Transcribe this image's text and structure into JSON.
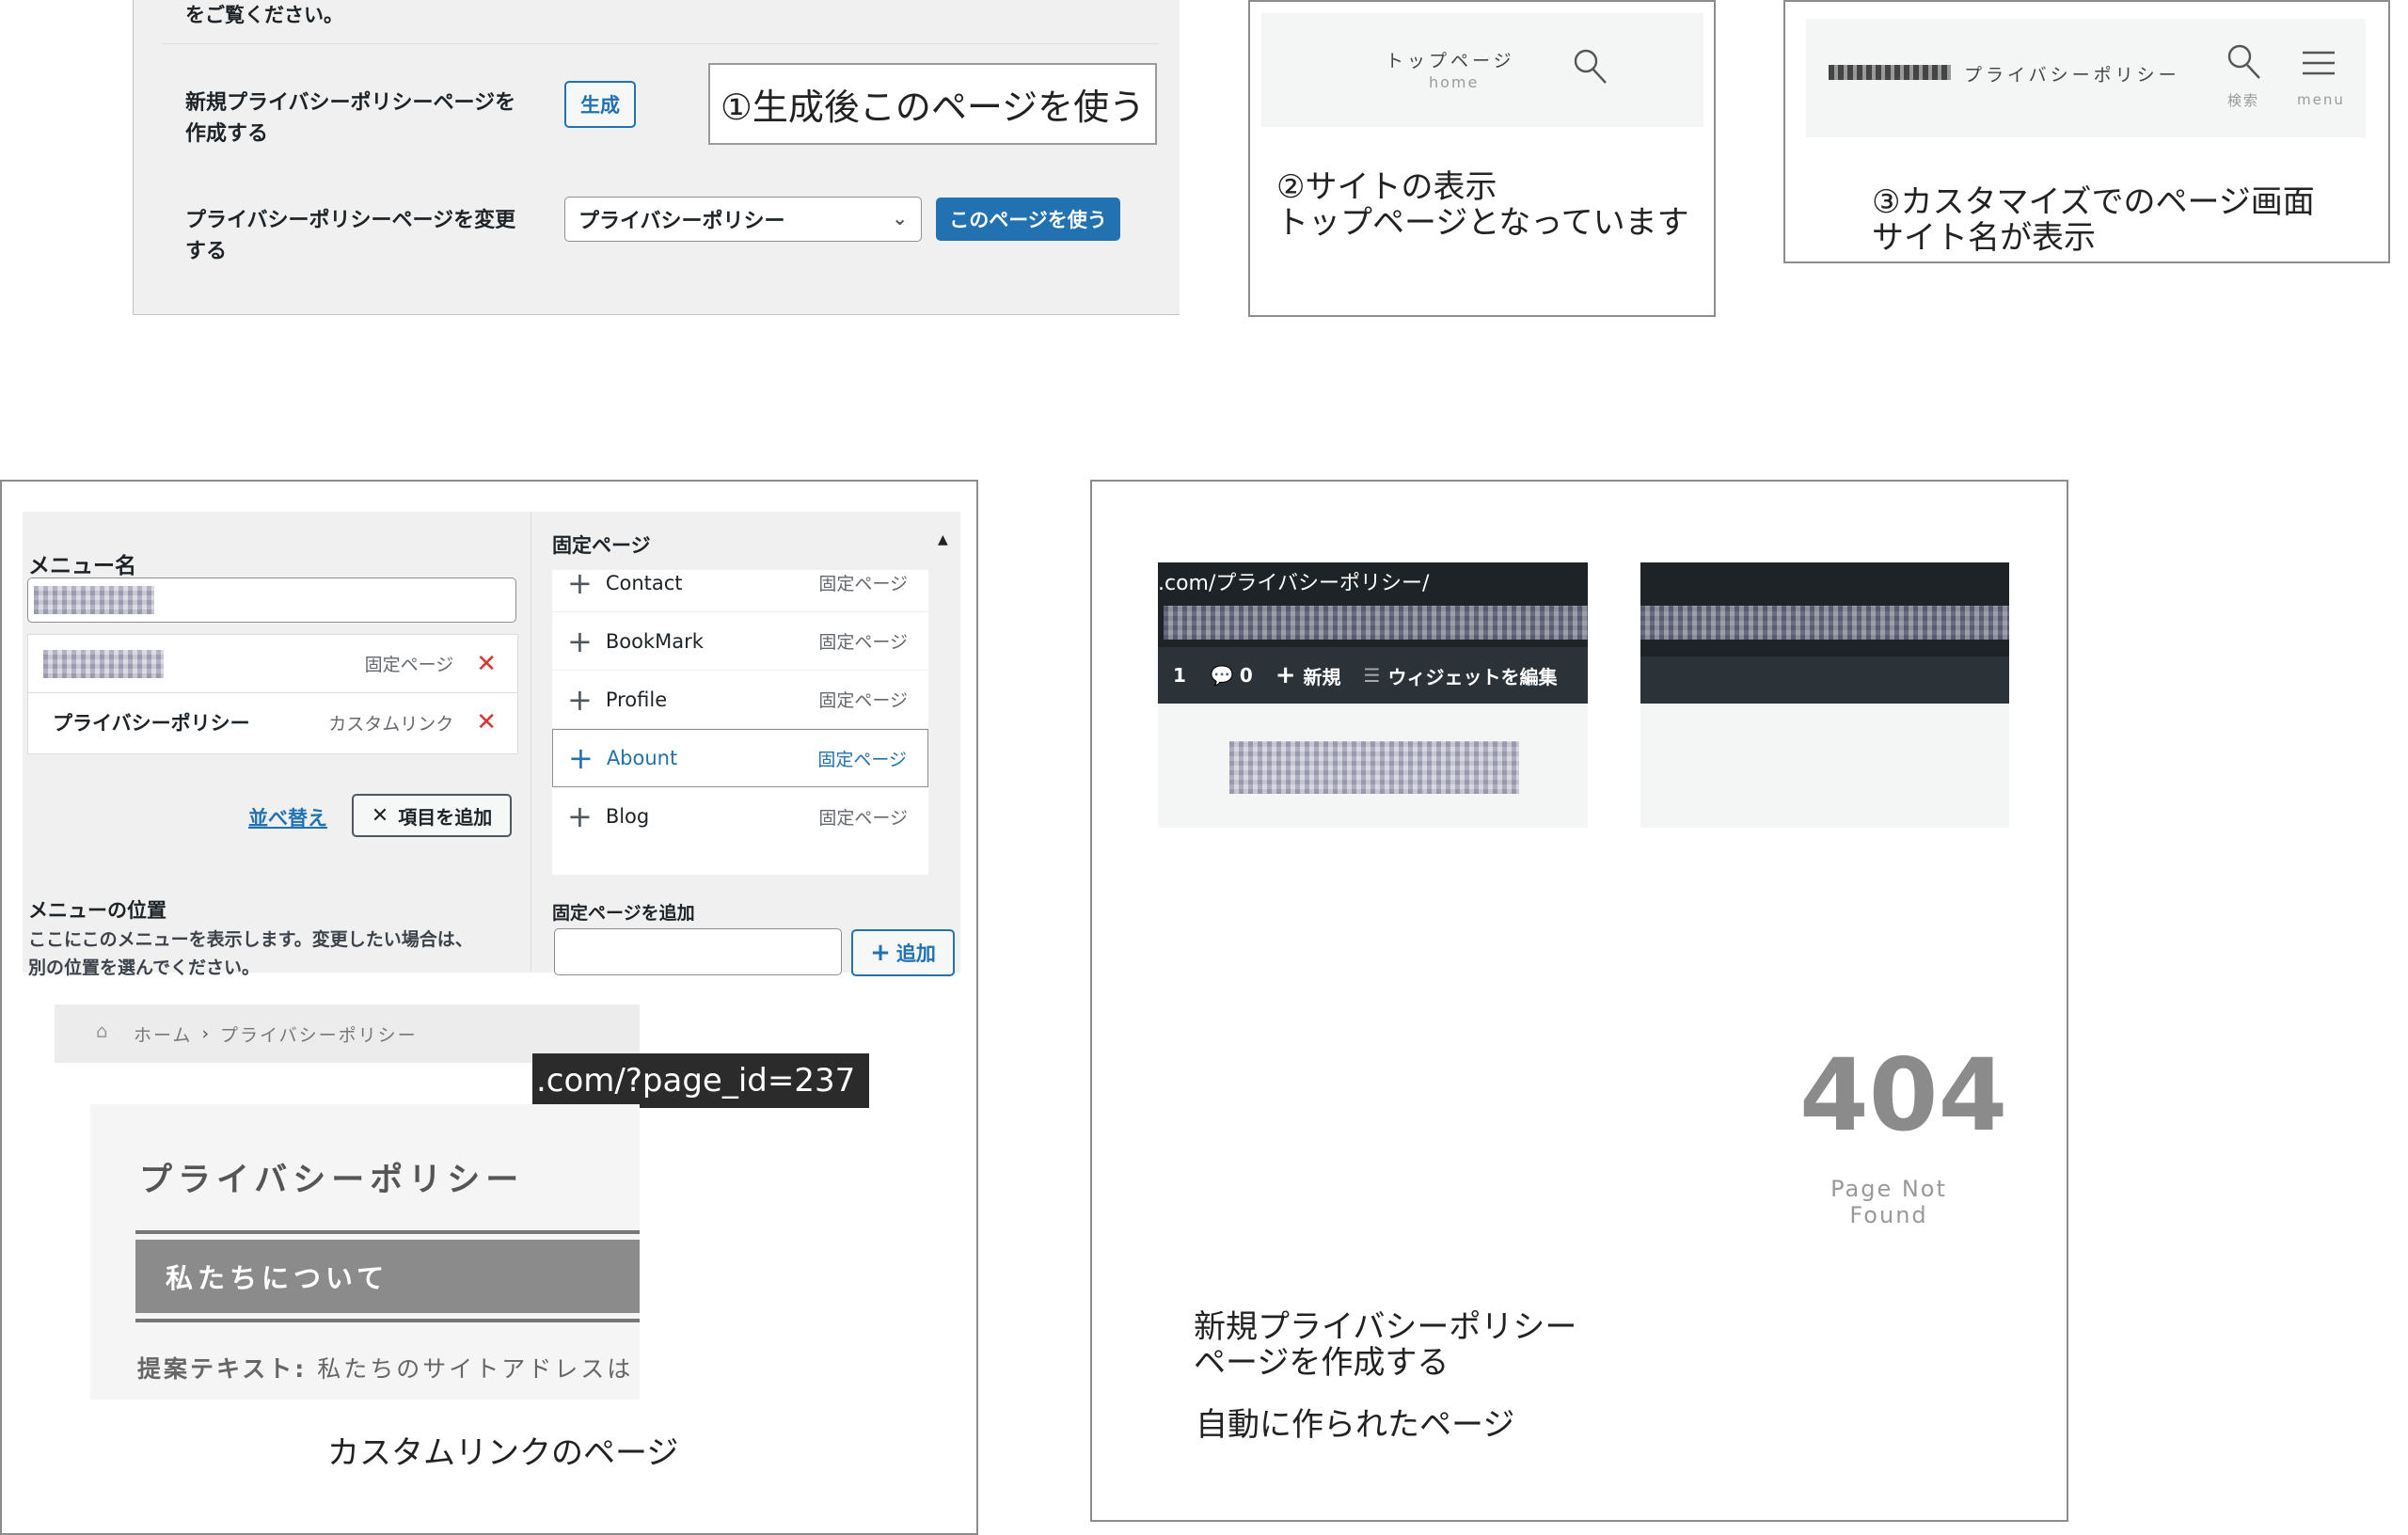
{
  "panel_settings": {
    "top_text": "をご覧ください。",
    "create_label": "新規プライバシーポリシーページを\n作成する",
    "generate_button": "生成",
    "callout_1": "①生成後このページを使う",
    "change_label": "プライバシーポリシーページを変更\nする",
    "select_value": "プライバシーポリシー",
    "use_page_button": "このページを使う"
  },
  "panel_site": {
    "nav_top": "トップページ",
    "nav_top_sub": "home",
    "caption": "②サイトの表示\nトップページとなっています"
  },
  "panel_customize": {
    "nav_privacy": "プライバシーポリシー",
    "search_label": "検索",
    "menu_label": "menu",
    "caption": "③カスタマイズでのページ画面\nサイト名が表示"
  },
  "panel_menu": {
    "menu_name_label": "メニュー名",
    "items": [
      {
        "type": "固定ページ"
      },
      {
        "title": "プライバシーポリシー",
        "type": "カスタムリンク"
      }
    ],
    "reorder_link": "並べ替え",
    "add_items_button": "項目を追加",
    "location_heading": "メニューの位置",
    "location_desc": "ここにこのメニューを表示します。変更したい場合は、\n別の位置を選んでください。",
    "fixed_pages_heading": "固定ページ",
    "pages": [
      {
        "title": "Contact",
        "type": "固定ページ"
      },
      {
        "title": "BookMark",
        "type": "固定ページ"
      },
      {
        "title": "Profile",
        "type": "固定ページ"
      },
      {
        "title": "Abount",
        "type": "固定ページ"
      },
      {
        "title": "Blog",
        "type": "固定ページ"
      }
    ],
    "add_page_label": "固定ページを追加",
    "add_button": "追加",
    "breadcrumb_home": "ホーム",
    "breadcrumb_sep": "›",
    "breadcrumb_current": "プライバシーポリシー",
    "url_tooltip": ".com/?page_id=237",
    "page_title": "プライバシーポリシー",
    "section_heading": "私たちについて",
    "body_bold": "提案テキスト:",
    "body_text": " 私たちのサイトアドレスは",
    "caption": "カスタムリンクのページ"
  },
  "panel_404": {
    "url": ".com/プライバシーポリシー/",
    "admin_count": "1",
    "comment_count": "0",
    "new_label": "新規",
    "widget_label": "ウィジェットを編集",
    "code": "404",
    "message": "Page Not Found",
    "caption_1": "新規プライバシーポリシー\nページを作成する",
    "caption_2": "自動に作られたページ"
  },
  "colors": {
    "wp_blue": "#2271b1",
    "wp_bg": "#f0f0f1",
    "delete_red": "#d63638",
    "admin_bar": "#1d2327"
  }
}
